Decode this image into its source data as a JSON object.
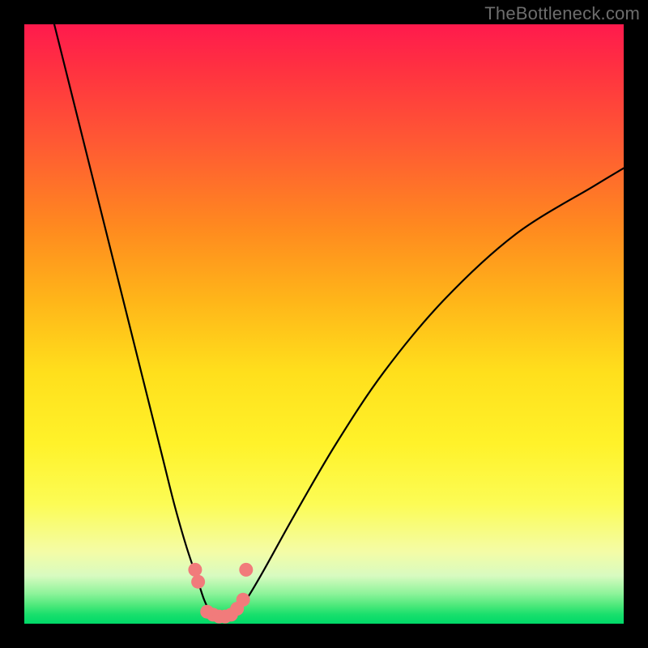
{
  "watermark": "TheBottleneck.com",
  "chart_data": {
    "type": "line",
    "title": "",
    "xlabel": "",
    "ylabel": "",
    "xlim": [
      0,
      100
    ],
    "ylim": [
      0,
      100
    ],
    "grid": false,
    "legend": false,
    "background_gradient": {
      "direction": "vertical",
      "stops": [
        {
          "pos": 0,
          "color": "#ff1a4d",
          "meaning": "worst"
        },
        {
          "pos": 50,
          "color": "#ffe01c",
          "meaning": "mid"
        },
        {
          "pos": 100,
          "color": "#00d968",
          "meaning": "best"
        }
      ]
    },
    "series": [
      {
        "name": "bottleneck-curve",
        "color": "#000000",
        "x": [
          5,
          8,
          11,
          14,
          17,
          20,
          23,
          25,
          27,
          29,
          30,
          31,
          32,
          33,
          34,
          35,
          37,
          40,
          45,
          52,
          60,
          70,
          82,
          95,
          100
        ],
        "y": [
          100,
          88,
          76,
          64,
          52,
          40,
          28,
          20,
          13,
          7,
          4,
          2,
          1,
          1,
          1,
          2,
          4,
          9,
          18,
          30,
          42,
          54,
          65,
          73,
          76
        ]
      },
      {
        "name": "highlight-dots",
        "color": "#f17b7b",
        "type": "scatter",
        "x": [
          28.5,
          29.0,
          30.5,
          31.5,
          32.5,
          33.5,
          34.5,
          35.5,
          36.5,
          37.0
        ],
        "y": [
          9.0,
          7.0,
          2.0,
          1.5,
          1.2,
          1.2,
          1.5,
          2.5,
          4.0,
          9.0
        ]
      }
    ],
    "annotations": []
  }
}
